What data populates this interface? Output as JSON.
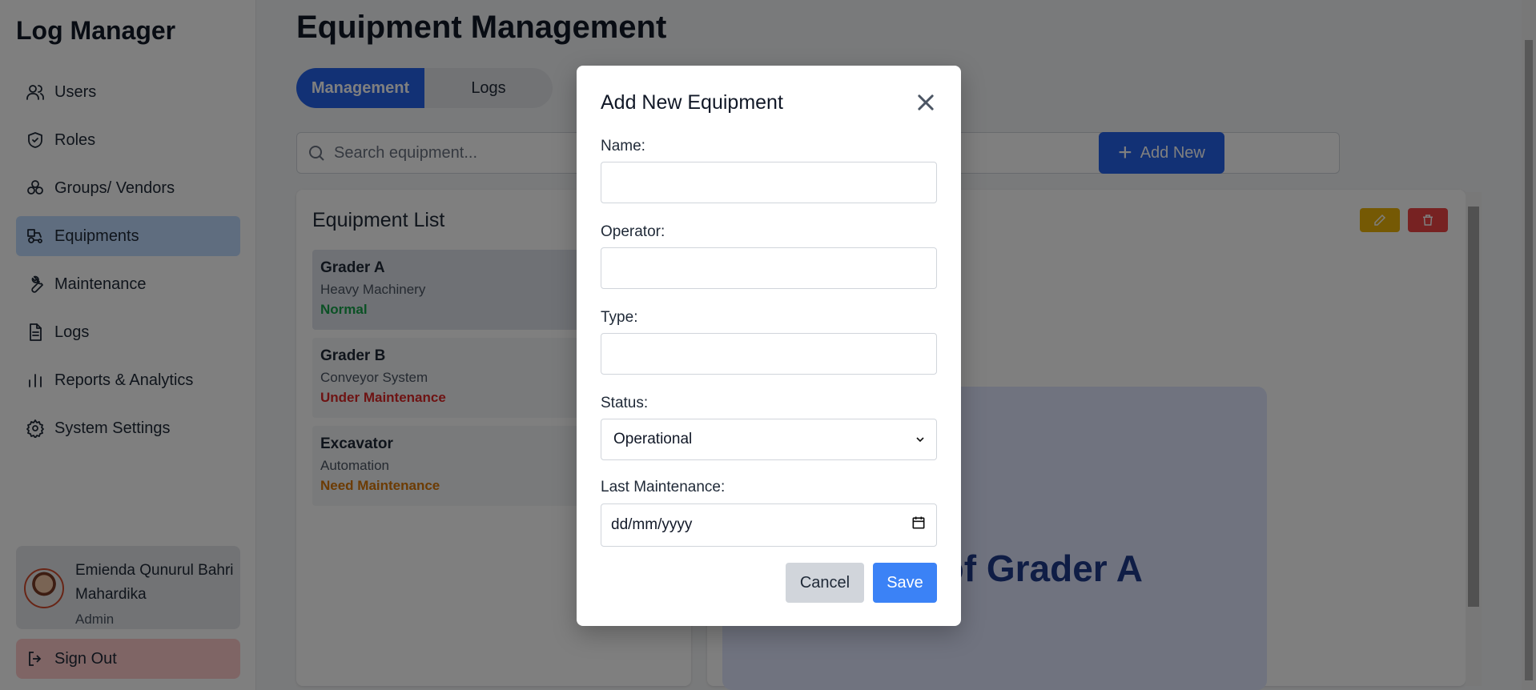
{
  "brand": "Log Manager",
  "nav": [
    {
      "label": "Users",
      "icon": "users-icon"
    },
    {
      "label": "Roles",
      "icon": "shield-icon"
    },
    {
      "label": "Groups/ Vendors",
      "icon": "groups-icon"
    },
    {
      "label": "Equipments",
      "icon": "tractor-icon",
      "active": true
    },
    {
      "label": "Maintenance",
      "icon": "wrench-icon"
    },
    {
      "label": "Logs",
      "icon": "document-icon"
    },
    {
      "label": "Reports & Analytics",
      "icon": "bar-chart-icon"
    },
    {
      "label": "System Settings",
      "icon": "gear-icon"
    }
  ],
  "profile": {
    "name": "Emienda Qunurul Bahri Mahardika",
    "role": "Admin"
  },
  "sign_out": "Sign Out",
  "page_title": "Equipment Management",
  "tabs": [
    {
      "label": "Management",
      "active": true
    },
    {
      "label": "Logs",
      "active": false
    }
  ],
  "search": {
    "placeholder": "Search equipment..."
  },
  "add_new": "Add New",
  "equipment_list": {
    "title": "Equipment List",
    "items": [
      {
        "name": "Grader A",
        "type": "Heavy Machinery",
        "status": "Normal",
        "status_color": "#16a34a"
      },
      {
        "name": "Grader B",
        "type": "Conveyor System",
        "status": "Under Maintenance",
        "status_color": "#dc2626"
      },
      {
        "name": "Excavator",
        "type": "Automation",
        "status": "Need Maintenance",
        "status_color": "#d97706"
      }
    ]
  },
  "detail": {
    "banner_text": "of Grader A"
  },
  "modal": {
    "title": "Add New Equipment",
    "fields": {
      "name_label": "Name:",
      "name_value": "",
      "operator_label": "Operator:",
      "operator_value": "",
      "type_label": "Type:",
      "type_value": "",
      "status_label": "Status:",
      "status_value": "Operational",
      "last_maintenance_label": "Last Maintenance:",
      "last_maintenance_placeholder": "dd/mm/yyyy"
    },
    "cancel": "Cancel",
    "save": "Save"
  },
  "colors": {
    "primary": "#2563eb",
    "edit": "#eab308",
    "delete": "#ef4444",
    "save": "#3b82f6"
  }
}
